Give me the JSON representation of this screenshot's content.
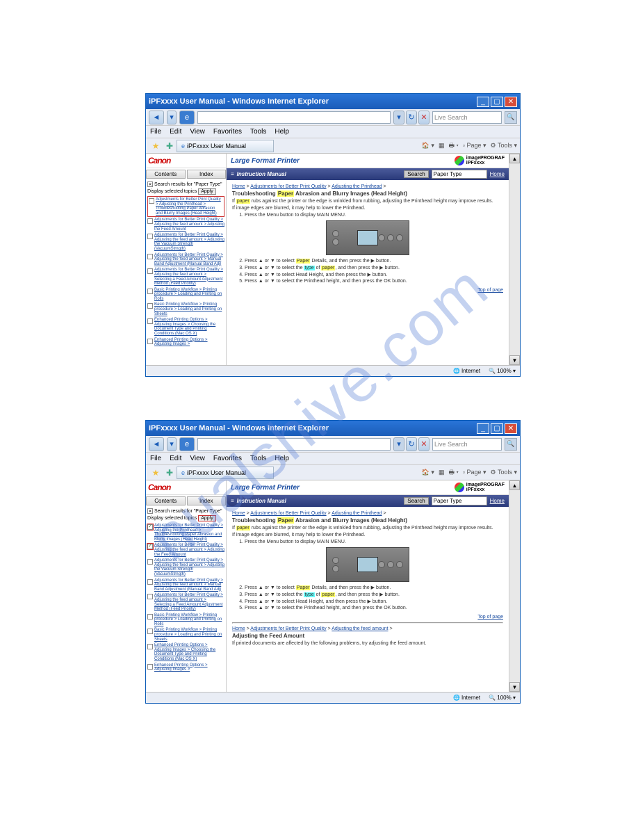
{
  "watermark": "nualshive.com",
  "browser": {
    "title": "iPFxxxx User Manual - Windows Internet Explorer",
    "search_placeholder": "Live Search",
    "menu": [
      "File",
      "Edit",
      "View",
      "Favorites",
      "Tools",
      "Help"
    ],
    "tab_label": "iPFxxxx User Manual",
    "tool_items": [
      "Page",
      "Tools"
    ],
    "status_internet": "Internet",
    "status_zoom": "100%"
  },
  "panel": {
    "canon": "Canon",
    "contents": "Contents",
    "index": "Index",
    "search_header": "Search results for \"Paper Type\"",
    "display_label": "Display selected topics",
    "apply": "Apply",
    "results": [
      "Adjustments for Better Print Quality > Adjusting the Printhead > Troubleshooting Paper Abrasion and Blurry Images (Head Height)",
      "Adjustments for Better Print Quality > Adjusting the feed amount > Adjusting the Feed Amount",
      "Adjustments for Better Print Quality > Adjusting the feed amount > Adjusting the Vacuum Strength (VacuumStrngth)",
      "Adjustments for Better Print Quality > Adjusting the feed amount > Manual Band Adjustment (Manual Band Adj)",
      "Adjustments for Better Print Quality > Adjusting the feed amount > Selecting a Feed Amount Adjustment Method (Feed Priority)",
      "Basic Printing Workflow > Printing procedure > Loading and Printing on Rolls",
      "Basic Printing Workflow > Printing procedure > Loading and Printing on Sheets",
      "Enhanced Printing Options > Adjusting Images > Choosing the Document Type and Printing Conditions (Mac OS X)",
      "Enhanced Printing Options > Adjusting Images >"
    ]
  },
  "header": {
    "lfp": "Large Format Printer",
    "prograf": "imagePROGRAF",
    "ipf": "iPFxxxx",
    "instruction": "Instruction Manual",
    "search_btn": "Search",
    "search_val": "Paper Type",
    "home": "Home"
  },
  "doc": {
    "breadcrumb_parts": [
      "Home",
      "Adjustments for Better Print Quality",
      "Adjusting the Printhead"
    ],
    "title_prefix": "Troubleshooting ",
    "title_hl": "Paper",
    "title_suffix": " Abrasion and Blurry Images (Head Height)",
    "para1_a": "If ",
    "para1_hl": "paper",
    "para1_b": " rubs against the printer or the edge is wrinkled from rubbing, adjusting the Printhead height may improve results.",
    "para2": "If image edges are blurred, it may help to lower the Printhead.",
    "step1": "Press the Menu button to display MAIN MENU.",
    "step2_a": "Press ▲ or ▼ to select ",
    "step2_hl": "Paper",
    "step2_b": " Details, and then press the ▶ button.",
    "step3_a": "Press ▲ or ▼ to select the ",
    "step3_hl1": "type",
    "step3_mid": " of ",
    "step3_hl2": "paper",
    "step3_b": ", and then press the ▶ button.",
    "step4": "Press ▲ or ▼ to select Head Height, and then press the ▶ button.",
    "step5": "Press ▲ or ▼ to select the Printhead height, and then press the OK button.",
    "top_of_page": "Top of page"
  },
  "doc2": {
    "breadcrumb_parts": [
      "Home",
      "Adjustments for Better Print Quality",
      "Adjusting the feed amount"
    ],
    "title": "Adjusting the Feed Amount",
    "para": "If printed documents are affected by the following problems, try adjusting the feed amount."
  }
}
